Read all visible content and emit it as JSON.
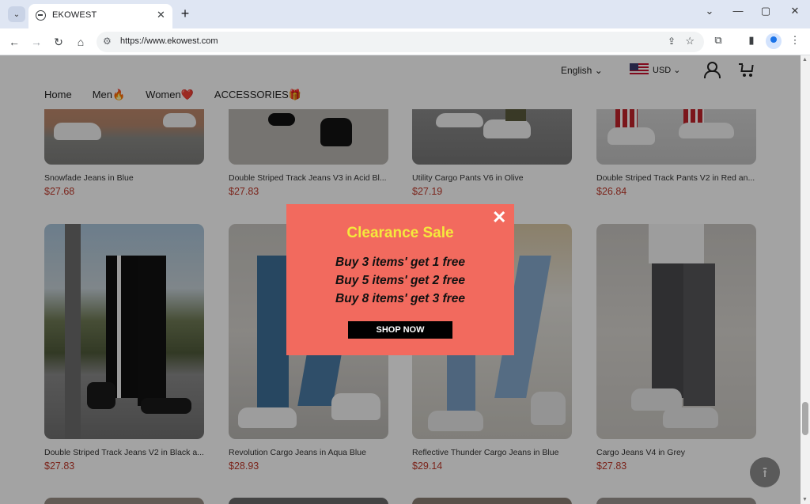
{
  "browser": {
    "tab_title": "EKOWEST",
    "url": "https://www.ekowest.com",
    "tab_close_glyph": "✕",
    "new_tab_glyph": "+",
    "controls": {
      "minimize": "—",
      "maximize": "▢",
      "close": "✕",
      "collapse": "⌄"
    }
  },
  "site": {
    "language": "English  ⌄",
    "currency": "USD  ⌄",
    "nav": [
      {
        "label": "Home"
      },
      {
        "label": "Men🔥"
      },
      {
        "label": "Women❤️"
      },
      {
        "label": "ACCESSORIES🎁"
      }
    ]
  },
  "products_top": [
    {
      "name": "Snowfade Jeans in Blue",
      "price": "$27.68"
    },
    {
      "name": "Double Striped Track Jeans V3 in Acid Bl...",
      "price": "$27.83"
    },
    {
      "name": "Utility Cargo Pants V6 in Olive",
      "price": "$27.19"
    },
    {
      "name": "Double Striped Track Pants V2 in Red an...",
      "price": "$26.84"
    }
  ],
  "products_mid": [
    {
      "name": "Double Striped Track Jeans V2 in Black a...",
      "price": "$27.83"
    },
    {
      "name": "Revolution Cargo Jeans in Aqua Blue",
      "price": "$28.93"
    },
    {
      "name": "Reflective Thunder Cargo Jeans in Blue",
      "price": "$29.14"
    },
    {
      "name": "Cargo Jeans V4 in Grey",
      "price": "$27.83"
    }
  ],
  "popup": {
    "close_glyph": "✕",
    "headline": "Clearance Sale",
    "offers": [
      "Buy 3 items' get 1 free",
      "Buy 5 items' get 2 free",
      "Buy 8 items' get 3 free"
    ],
    "cta": "SHOP NOW"
  },
  "colors": {
    "popup_bg": "#f26a5e",
    "headline": "#f5e93c",
    "price": "#c0392b"
  }
}
